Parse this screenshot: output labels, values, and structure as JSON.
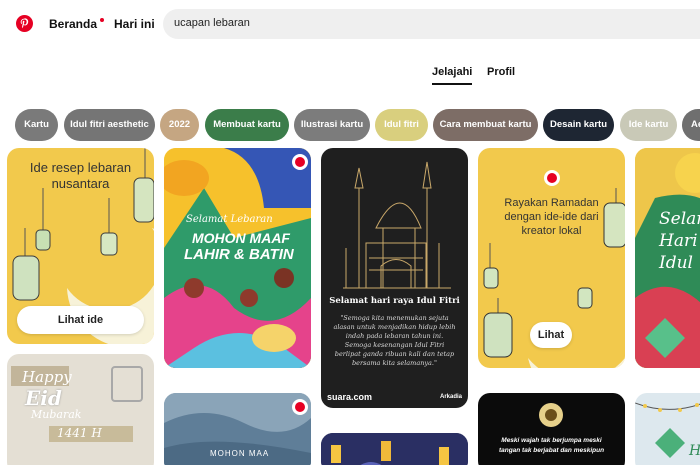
{
  "header": {
    "nav": [
      "Beranda",
      "Hari ini"
    ],
    "search_value": "ucapan lebaran"
  },
  "tabs": [
    "Jelajahi",
    "Profil"
  ],
  "chips": [
    {
      "label": "Kartu",
      "color": "#7a7a7a"
    },
    {
      "label": "Idul fitri aesthetic",
      "color": "#757575"
    },
    {
      "label": "2022",
      "color": "#c5a682"
    },
    {
      "label": "Membuat kartu",
      "color": "#3b7d4a"
    },
    {
      "label": "Ilustrasi kartu",
      "color": "#7c7c7c"
    },
    {
      "label": "Idul fitri",
      "color": "#d9cf7e"
    },
    {
      "label": "Cara membuat kartu",
      "color": "#7d6d66"
    },
    {
      "label": "Desain kartu",
      "color": "#1e2633"
    },
    {
      "label": "Ide kartu",
      "color": "#c9c9b7"
    },
    {
      "label": "Ae",
      "color": "#6f6f6f"
    }
  ],
  "pins": {
    "resep": {
      "title": "Ide resep lebaran nusantara",
      "button": "Lihat ide"
    },
    "maaf": {
      "line1": "Selamat Lebaran",
      "line2": "MOHON MAAF",
      "line3": "LAHIR & BATIN"
    },
    "mosque": {
      "title": "Selamat hari raya Idul Fitri",
      "quote": "\"Semoga kita menemukan sejuta alasan untuk menjadikan hidup lebih indah pada lebaran tahun ini. Semoga kesenangan Idul Fitri berlipat ganda ribuan kali dan tetap bersama kita selamanya.\"",
      "source": "suara.com",
      "brand": "Arkadia"
    },
    "ramadan": {
      "title": "Rayakan Ramadan dengan ide-ide dari kreator lokal",
      "button": "Lihat"
    },
    "selamat_partial": "Selam Hari Idul",
    "happy": {
      "line1": "Happy",
      "line2": "Eid",
      "line3": "Mubarak",
      "line4": "1441 H"
    },
    "mohon_partial": "MOHON MAA",
    "meski": {
      "line1": "Meski wajah tak berjumpa meski",
      "line2": "tangan tak berjabat dan meskipun"
    },
    "bottom_right": "Ha"
  },
  "colors": {
    "brand": "#e60023",
    "yellow": "#f2c94c"
  }
}
